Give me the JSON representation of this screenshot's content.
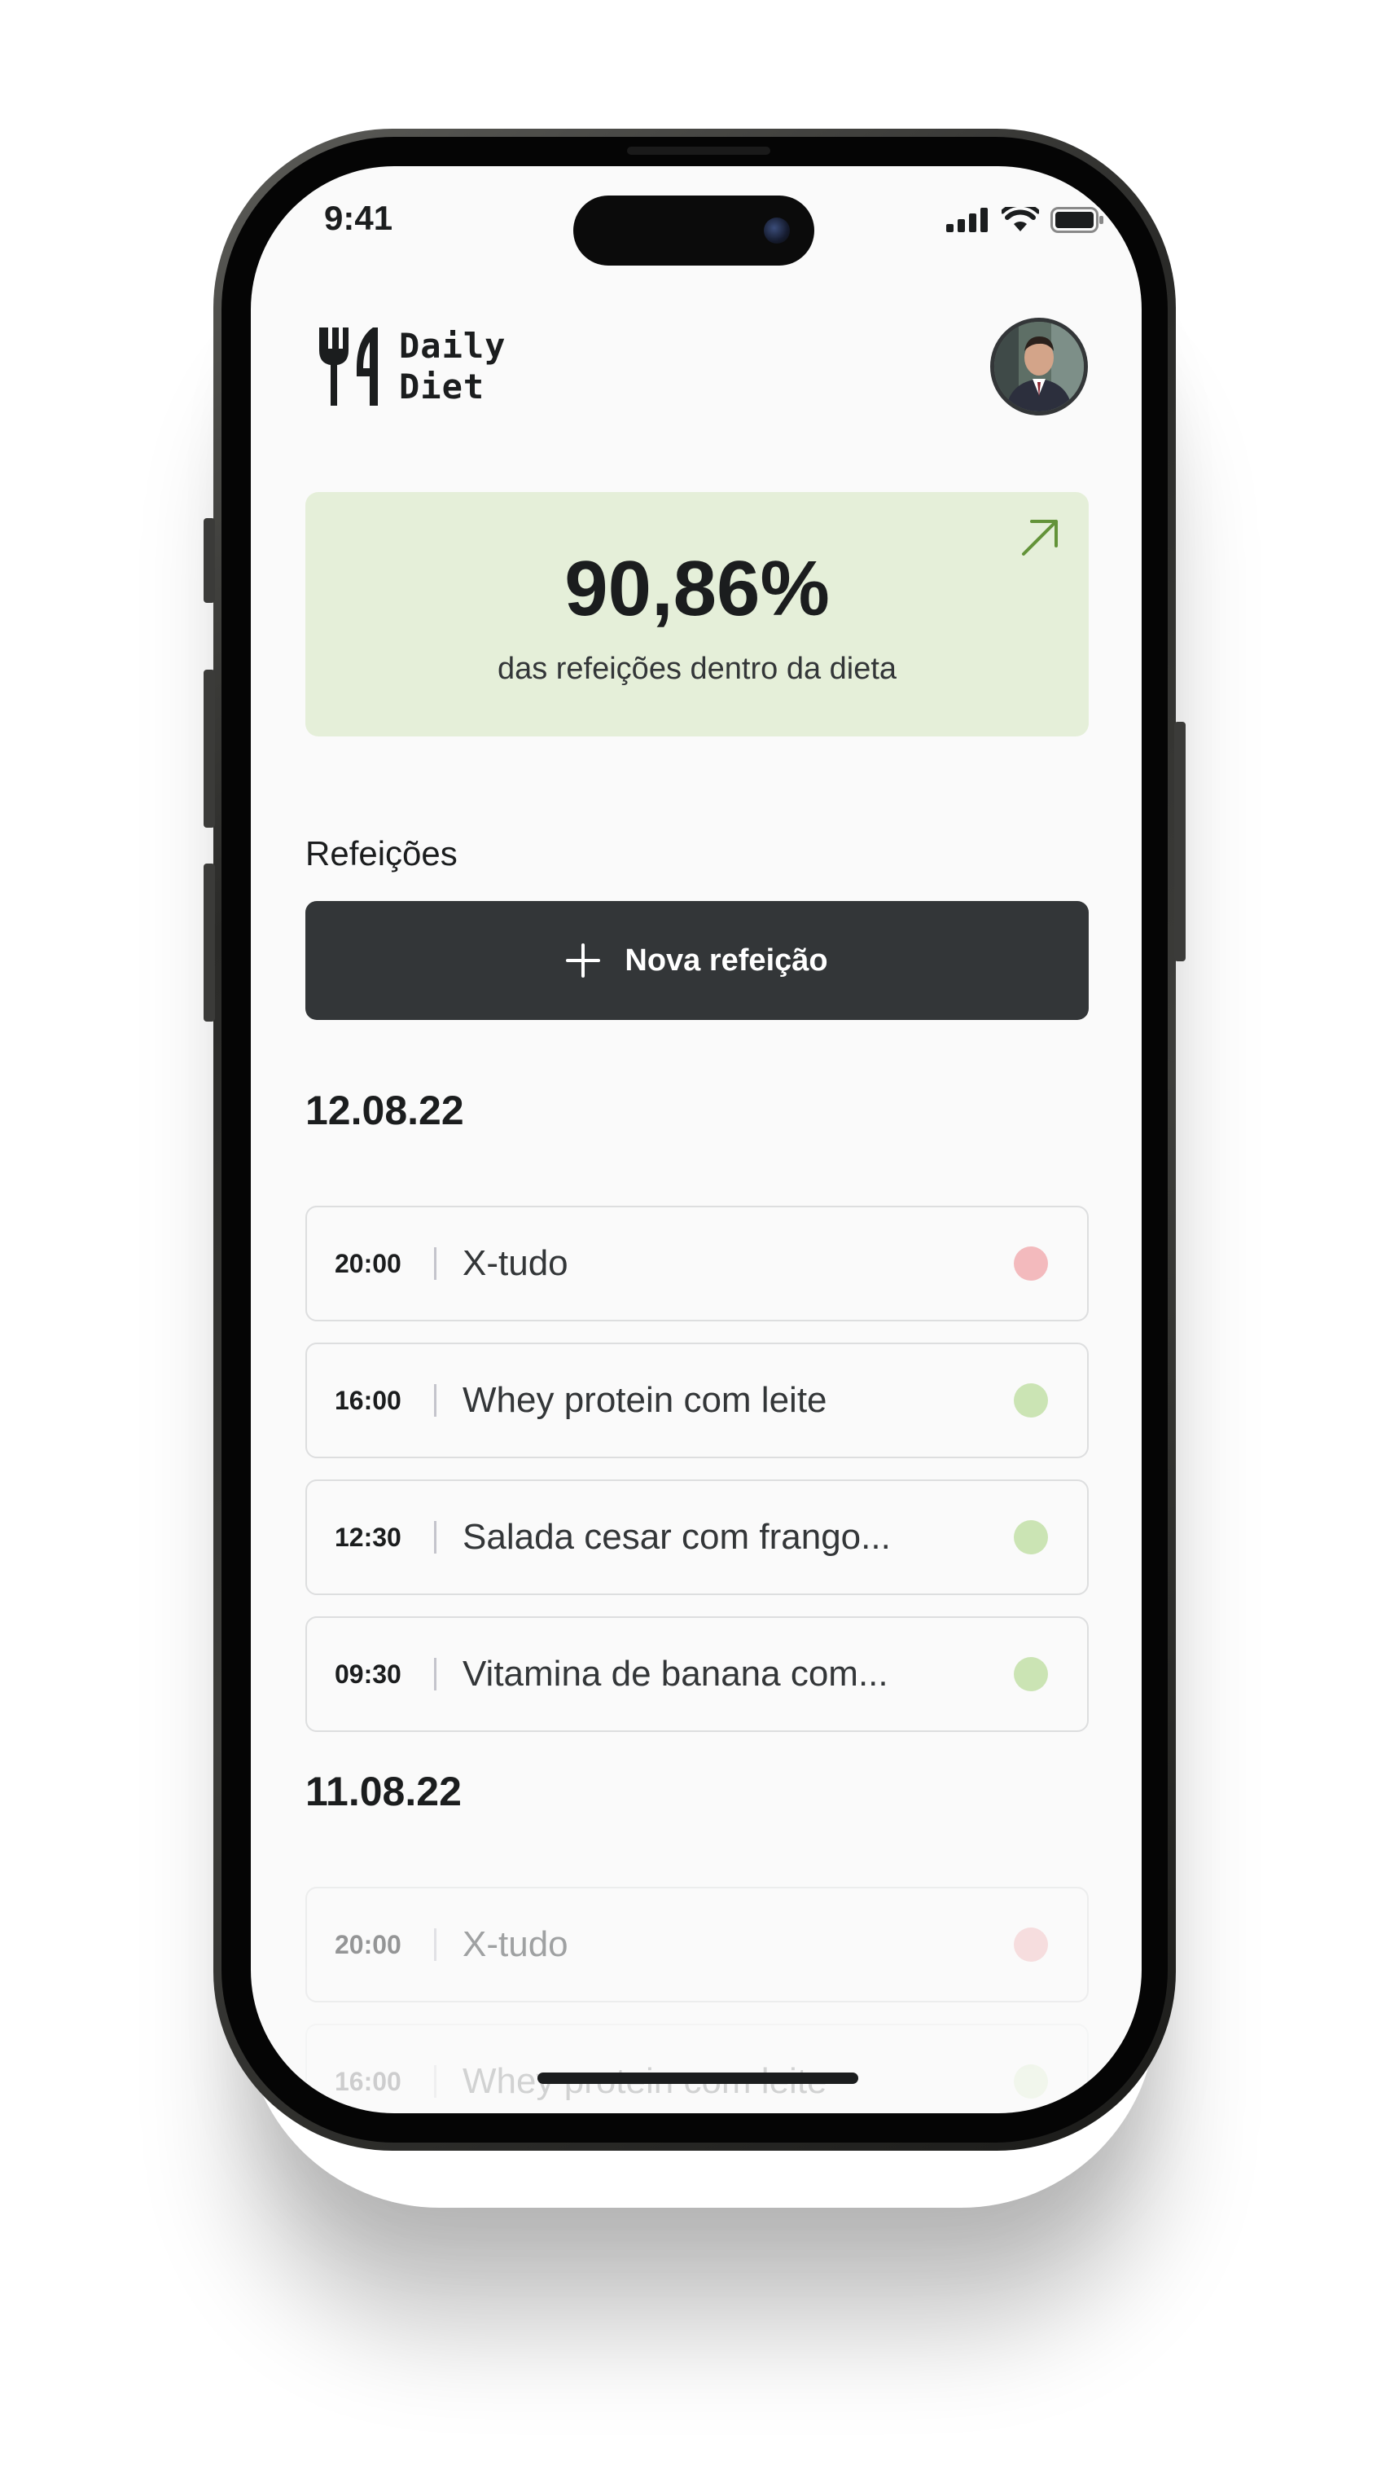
{
  "status_bar": {
    "time": "9:41",
    "icons": [
      "cellular-signal-icon",
      "wifi-icon",
      "battery-icon"
    ]
  },
  "header": {
    "logo_line1": "Daily",
    "logo_line2": "Diet",
    "logo_icon": "fork-knife-icon",
    "avatar": "user-avatar"
  },
  "stats_card": {
    "percent": "90,86%",
    "label": "das refeições dentro da dieta",
    "arrow_icon": "arrow-up-right-icon",
    "background_color": "#e5efd9",
    "arrow_color": "#639339"
  },
  "meals_section": {
    "title": "Refeições",
    "new_meal_label": "Nova refeição",
    "new_meal_icon": "plus-icon"
  },
  "days": [
    {
      "date": "12.08.22",
      "meals": [
        {
          "time": "20:00",
          "name": "X-tudo",
          "in_diet": false
        },
        {
          "time": "16:00",
          "name": "Whey protein com leite",
          "in_diet": true
        },
        {
          "time": "12:30",
          "name": "Salada cesar com frango...",
          "in_diet": true
        },
        {
          "time": "09:30",
          "name": "Vitamina de banana com...",
          "in_diet": true
        }
      ]
    },
    {
      "date": "11.08.22",
      "meals": [
        {
          "time": "20:00",
          "name": "X-tudo",
          "in_diet": false
        },
        {
          "time": "16:00",
          "name": "Whey protein com leite",
          "in_diet": true
        }
      ]
    }
  ],
  "colors": {
    "in_diet_dot": "#cbe4b4",
    "off_diet_dot": "#f3babd",
    "button_dark": "#333638"
  }
}
